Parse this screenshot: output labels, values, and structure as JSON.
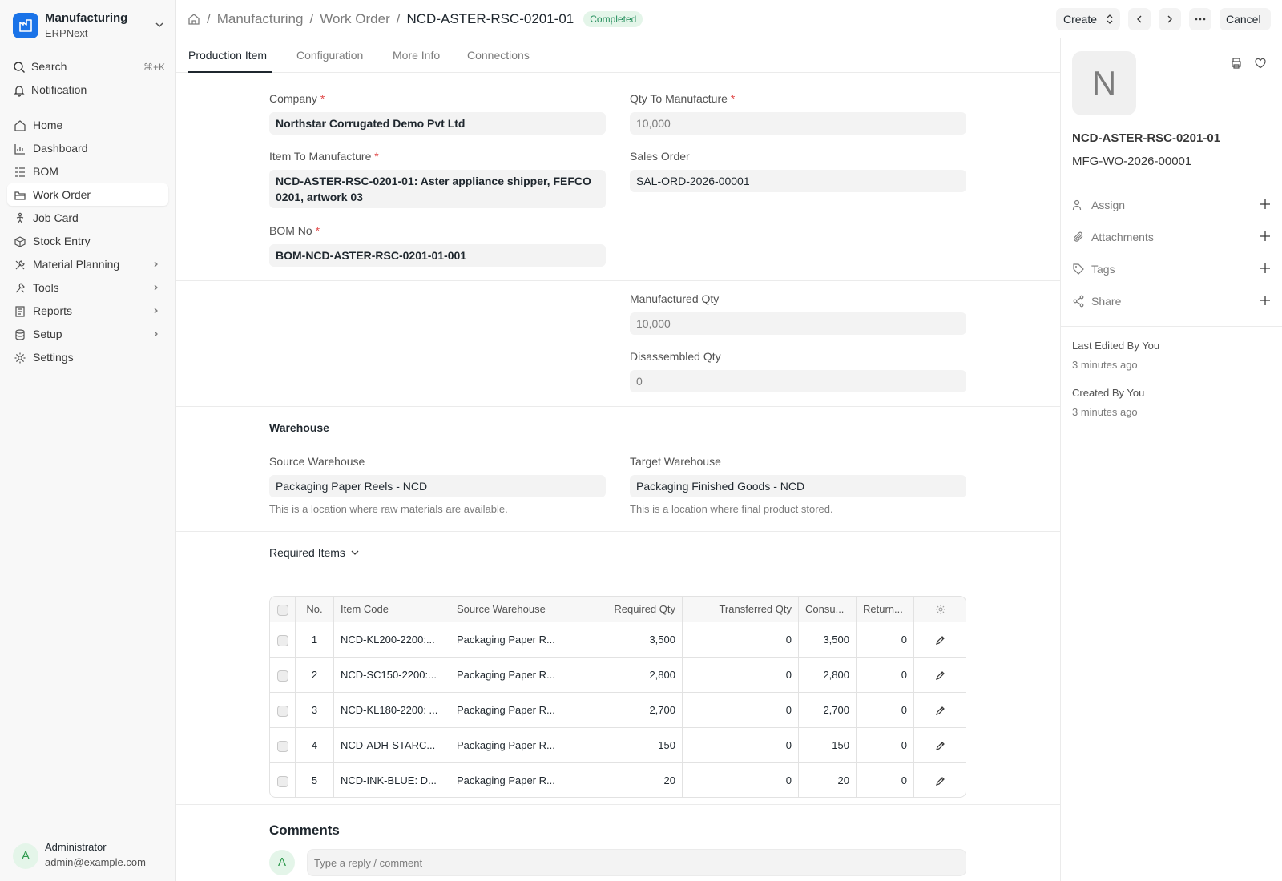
{
  "app": {
    "name": "Manufacturing",
    "sub": "ERPNext"
  },
  "sidebar": {
    "search_label": "Search",
    "search_shortcut": "⌘+K",
    "notification_label": "Notification",
    "items": [
      {
        "label": "Home",
        "icon": "home-icon"
      },
      {
        "label": "Dashboard",
        "icon": "chart-icon"
      },
      {
        "label": "BOM",
        "icon": "list-icon"
      },
      {
        "label": "Work Order",
        "icon": "folder-icon",
        "active": true
      },
      {
        "label": "Job Card",
        "icon": "person-icon"
      },
      {
        "label": "Stock Entry",
        "icon": "box-icon"
      },
      {
        "label": "Material Planning",
        "icon": "wrench-icon",
        "expandable": true
      },
      {
        "label": "Tools",
        "icon": "tools-icon",
        "expandable": true
      },
      {
        "label": "Reports",
        "icon": "report-icon",
        "expandable": true
      },
      {
        "label": "Setup",
        "icon": "database-icon",
        "expandable": true
      },
      {
        "label": "Settings",
        "icon": "gear-icon"
      }
    ],
    "user": {
      "initial": "A",
      "name": "Administrator",
      "email": "admin@example.com"
    }
  },
  "header": {
    "breadcrumbs": [
      "Manufacturing",
      "Work Order"
    ],
    "doc_title": "NCD-ASTER-RSC-0201-01",
    "status": "Completed",
    "create_label": "Create",
    "cancel_label": "Cancel"
  },
  "tabs": [
    "Production Item",
    "Configuration",
    "More Info",
    "Connections"
  ],
  "form": {
    "company": {
      "label": "Company",
      "value": "Northstar Corrugated Demo Pvt Ltd"
    },
    "qty_to_manufacture": {
      "label": "Qty To Manufacture",
      "value": "10,000"
    },
    "item_to_manufacture": {
      "label": "Item To Manufacture",
      "value": "NCD-ASTER-RSC-0201-01: Aster appliance shipper, FEFCO 0201, artwork 03"
    },
    "sales_order": {
      "label": "Sales Order",
      "value": "SAL-ORD-2026-00001"
    },
    "bom_no": {
      "label": "BOM No",
      "value": "BOM-NCD-ASTER-RSC-0201-01-001"
    },
    "manufactured_qty": {
      "label": "Manufactured Qty",
      "value": "10,000"
    },
    "disassembled_qty": {
      "label": "Disassembled Qty",
      "value": "0"
    },
    "warehouse_section": "Warehouse",
    "source_warehouse": {
      "label": "Source Warehouse",
      "value": "Packaging Paper Reels - NCD",
      "description": "This is a location where raw materials are available."
    },
    "target_warehouse": {
      "label": "Target Warehouse",
      "value": "Packaging Finished Goods - NCD",
      "description": "This is a location where final product stored."
    },
    "required_items_section": "Required Items"
  },
  "required_items": {
    "columns": [
      "No.",
      "Item Code",
      "Source Warehouse",
      "Required Qty",
      "Transferred Qty",
      "Consu...",
      "Return..."
    ],
    "rows": [
      {
        "no": "1",
        "item_code": "NCD-KL200-2200:...",
        "source_warehouse": "Packaging Paper R...",
        "required_qty": "3,500",
        "transferred_qty": "0",
        "consumed_qty": "3,500",
        "returned_qty": "0"
      },
      {
        "no": "2",
        "item_code": "NCD-SC150-2200:...",
        "source_warehouse": "Packaging Paper R...",
        "required_qty": "2,800",
        "transferred_qty": "0",
        "consumed_qty": "2,800",
        "returned_qty": "0"
      },
      {
        "no": "3",
        "item_code": "NCD-KL180-2200: ...",
        "source_warehouse": "Packaging Paper R...",
        "required_qty": "2,700",
        "transferred_qty": "0",
        "consumed_qty": "2,700",
        "returned_qty": "0"
      },
      {
        "no": "4",
        "item_code": "NCD-ADH-STARC...",
        "source_warehouse": "Packaging Paper R...",
        "required_qty": "150",
        "transferred_qty": "0",
        "consumed_qty": "150",
        "returned_qty": "0"
      },
      {
        "no": "5",
        "item_code": "NCD-INK-BLUE: D...",
        "source_warehouse": "Packaging Paper R...",
        "required_qty": "20",
        "transferred_qty": "0",
        "consumed_qty": "20",
        "returned_qty": "0"
      }
    ]
  },
  "comments": {
    "title": "Comments",
    "avatar_initial": "A",
    "placeholder": "Type a reply / comment"
  },
  "right_sidebar": {
    "avatar_initial": "N",
    "title": "NCD-ASTER-RSC-0201-01",
    "subtitle": "MFG-WO-2026-00001",
    "actions": [
      "Assign",
      "Attachments",
      "Tags",
      "Share"
    ],
    "last_edited": "Last Edited By You",
    "last_edited_time": "3 minutes ago",
    "created": "Created By You",
    "created_time": "3 minutes ago"
  },
  "colors": {
    "accent": "#1a73e8",
    "status_bg": "#e4f5e9",
    "status_text": "#278f5e",
    "required_marker": "#e24c4c"
  }
}
